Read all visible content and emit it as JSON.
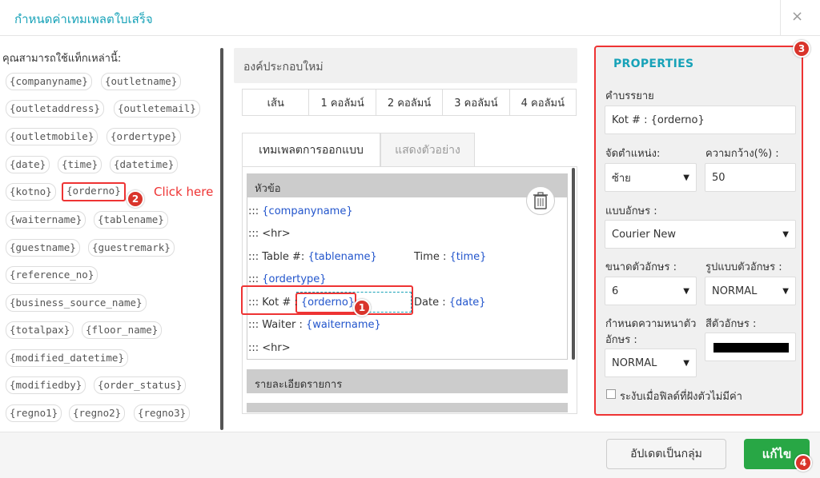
{
  "dialog": {
    "title": "กำหนดค่าเทมเพลตใบเสร็จ",
    "close": "×"
  },
  "tags": {
    "heading": "คุณสามารถใช้แท็กเหล่านี้:",
    "items": [
      "{companyname}",
      "{outletname}",
      "{outletaddress}",
      "{outletemail}",
      "{outletmobile}",
      "{ordertype}",
      "{date}",
      "{time}",
      "{datetime}",
      "{kotno}",
      "{orderno}",
      "{waitername}",
      "{tablename}",
      "{guestname}",
      "{guestremark}",
      "{reference_no}",
      "{business_source_name}",
      "{totalpax}",
      "{floor_name}",
      "{modified_datetime}",
      "{modifiedby}",
      "{order_status}",
      "{regno1}",
      "{regno2}",
      "{regno3}"
    ],
    "click_here": "Click here"
  },
  "middle": {
    "new_component": "องค์ประกอบใหม่",
    "column_buttons": [
      "เส้น",
      "1 คอลัมน์",
      "2 คอลัมน์",
      "3 คอลัมน์",
      "4 คอลัมน์"
    ],
    "tabs": [
      "เทมเพลตการออกแบบ",
      "แสดงตัวอย่าง"
    ],
    "section_header": "หัวข้อ",
    "rows": {
      "r1_prefix": "::: ",
      "r1_var": "{companyname}",
      "r2": "::: <hr>",
      "r3_prefix": "::: Table #: ",
      "r3_var": "{tablename}",
      "r3b_label": "Time : ",
      "r3b_var": "{time}",
      "r4_prefix": "::: ",
      "r4_var": "{ordertype}",
      "r5_prefix": "::: Kot # : ",
      "r5_var": "{orderno}",
      "r5b_label": "Date : ",
      "r5b_var": "{date}",
      "r6_prefix": "::: Waiter : ",
      "r6_var": "{waitername}",
      "r7": "::: <hr>"
    },
    "section2": "รายละเอียดรายการ"
  },
  "properties": {
    "title": "PROPERTIES",
    "desc_label": "คำบรรยาย",
    "desc_value": "Kot # : {orderno}",
    "align_label": "จัดตำแหน่ง:",
    "align_value": "ซ้าย",
    "width_label": "ความกว้าง(%) :",
    "width_value": "50",
    "font_label": "แบบอักษร :",
    "font_value": "Courier New",
    "size_label": "ขนาดตัวอักษร :",
    "size_value": "6",
    "style_label": "รูปแบบตัวอักษร :",
    "style_value": "NORMAL",
    "weight_label_1": "กำหนดความหนาตัว",
    "weight_label_2": "อักษร :",
    "weight_value": "NORMAL",
    "color_label": "สีตัวอักษร :",
    "text_color": "#000000",
    "hide_label": "ระงับเมื่อฟิลด์ที่ฝังตัวไม่มีค่า"
  },
  "footer": {
    "update_button": "อัปเดตเป็นกลุ่ม",
    "save_button": "แก้ไข"
  },
  "badges": [
    "1",
    "2",
    "3",
    "4"
  ],
  "caret": "▼",
  "icons": {
    "trash": "trash-icon"
  }
}
